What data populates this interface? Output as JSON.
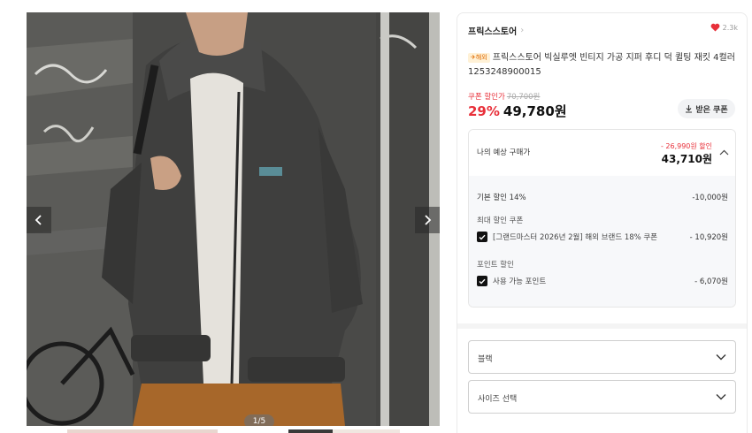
{
  "gallery": {
    "counter": "1/5"
  },
  "store": {
    "name": "프릭스스토어",
    "chevron": "›",
    "like_count": "2.3k"
  },
  "product": {
    "badge": "✈해외",
    "title": "프릭스스토어 빅실루엣 빈티지 가공 지퍼 후디 덕 퀼팅 재킷 4컬러 1253248900015"
  },
  "price": {
    "coupon_label": "쿠폰 할인가",
    "original": "70,700원",
    "discount_pct": "29%",
    "sale": "49,780원",
    "coupon_button": "받은 쿠폰"
  },
  "estimate": {
    "label": "나의 예상 구매가",
    "discount": "- 26,990원 할인",
    "price": "43,710원",
    "base_label": "기본 할인 14%",
    "base_amount": "-10,000원",
    "coupon_section": "최대 할인 쿠폰",
    "coupon_item": "[그랜드마스터 2026년 2월] 해외 브랜드 18% 쿠폰",
    "coupon_amount": "- 10,920원",
    "point_section": "포인트 할인",
    "point_item": "사용 가능 포인트",
    "point_amount": "- 6,070원"
  },
  "options": {
    "color": "블랙",
    "size": "사이즈 선택"
  },
  "colors": {
    "accent": "#e8303a",
    "heart": "#e8303a"
  },
  "icons": {
    "like": "heart-icon",
    "prev": "chevron-left-icon",
    "next": "chevron-right-icon",
    "download": "download-icon",
    "expand": "chevron-up-icon",
    "check": "check-icon",
    "dropdown": "chevron-down-icon"
  }
}
